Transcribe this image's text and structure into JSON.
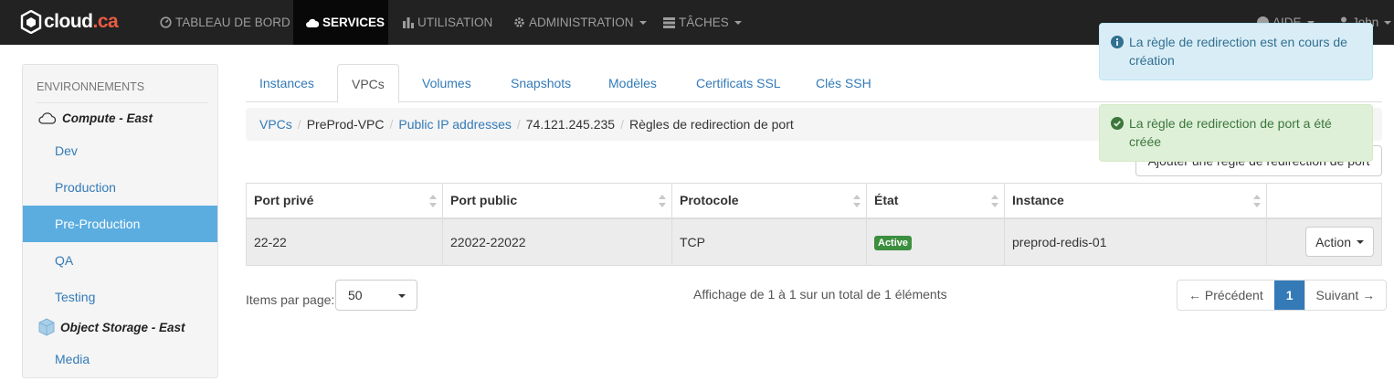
{
  "brand": {
    "name": "cloud",
    "tld": ".ca",
    "accent": "#ea5b43"
  },
  "topnav": {
    "items": [
      {
        "label": "TABLEAU DE BORD",
        "icon": "dashboard-icon"
      },
      {
        "label": "SERVICES",
        "icon": "cloud-icon",
        "active": true
      },
      {
        "label": "UTILISATION",
        "icon": "bar-chart-icon"
      },
      {
        "label": "ADMINISTRATION",
        "icon": "gear-icon"
      },
      {
        "label": "TÂCHES",
        "icon": "tasks-icon"
      }
    ],
    "help_label": "AIDE",
    "user_label": "John"
  },
  "sidebar": {
    "heading": "ENVIRONNEMENTS",
    "groups": [
      {
        "label": "Compute - East",
        "icon": "cloud-outline-icon"
      },
      {
        "label": "Object Storage - East",
        "icon": "storage-cube-icon"
      }
    ],
    "items": [
      {
        "label": "Dev"
      },
      {
        "label": "Production"
      },
      {
        "label": "Pre-Production",
        "active": true
      },
      {
        "label": "QA"
      },
      {
        "label": "Testing"
      },
      {
        "label": "Media"
      }
    ]
  },
  "tabs": [
    {
      "label": "Instances"
    },
    {
      "label": "VPCs",
      "active": true
    },
    {
      "label": "Volumes"
    },
    {
      "label": "Snapshots"
    },
    {
      "label": "Modèles"
    },
    {
      "label": "Certificats SSL"
    },
    {
      "label": "Clés SSH"
    }
  ],
  "breadcrumb": [
    "VPCs",
    "PreProd-VPC",
    "Public IP addresses",
    "74.121.245.235",
    "Règles de redirection de port"
  ],
  "add_button_label": "Ajouter une règle de redirection de port",
  "table": {
    "columns": [
      "Port privé",
      "Port public",
      "Protocole",
      "État",
      "Instance",
      ""
    ],
    "rows": [
      {
        "private_port": "22-22",
        "public_port": "22022-22022",
        "protocol": "TCP",
        "state": "Active",
        "instance": "preprod-redis-01",
        "action_label": "Action"
      }
    ]
  },
  "pagination": {
    "items_per_page_label": "Items par page:",
    "items_per_page_value": "50",
    "summary": "Affichage de 1 à 1 sur un total de 1 éléments",
    "prev_label": "← Précédent",
    "current_page": "1",
    "next_label": "Suivant →"
  },
  "alerts": [
    {
      "type": "info",
      "icon": "info-circle-icon",
      "text": "La règle de redirection est en cours de création"
    },
    {
      "type": "success",
      "icon": "check-circle-icon",
      "text": "La règle de redirection de port a été créée"
    }
  ],
  "colors": {
    "nav_bg": "#222222",
    "link": "#337ab7",
    "sidebar_active": "#5bade0",
    "badge_green": "#3c8f3e",
    "pager_active": "#337ab7"
  }
}
